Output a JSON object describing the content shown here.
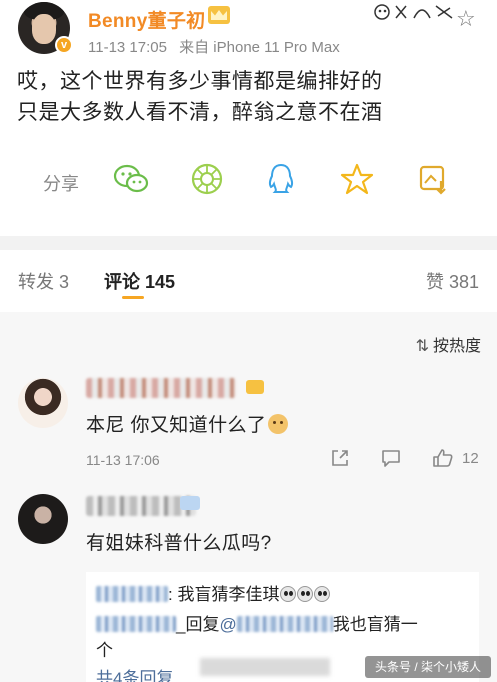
{
  "post": {
    "username": "Benny董子初",
    "time": "11-13 17:05",
    "source": "来自 iPhone 11 Pro Max",
    "text_line1": "哎，这个世界有多少事情都是编排好的",
    "text_line2": "只是大多数人看不清，醉翁之意不在酒",
    "share_label": "分享",
    "share_icons": [
      "wechat-icon",
      "moments-icon",
      "qq-icon",
      "qzone-star-icon",
      "save-image-icon"
    ]
  },
  "tabs": {
    "repost": "转发 3",
    "comments": "评论 145",
    "likes": "赞 381"
  },
  "sort": {
    "label": "按热度"
  },
  "comments": [
    {
      "text": "本尼 你又知道什么了",
      "time": "11-13 17:06",
      "like_count": "12"
    },
    {
      "text": "有姐妹科普什么瓜吗?",
      "replies": [
        {
          "text": ": 我盲猜李佳琪"
        },
        {
          "reply_word": "_回复",
          "at": "@",
          "text": "我也盲猜一"
        },
        {
          "text": "个"
        }
      ],
      "more_replies": "共4条回复"
    }
  ],
  "watermark": "头条号 / 柒个小矮人",
  "colors": {
    "username": "#f28a25",
    "tab_underline": "#f6a623",
    "link_blue": "#4d6e9a"
  }
}
